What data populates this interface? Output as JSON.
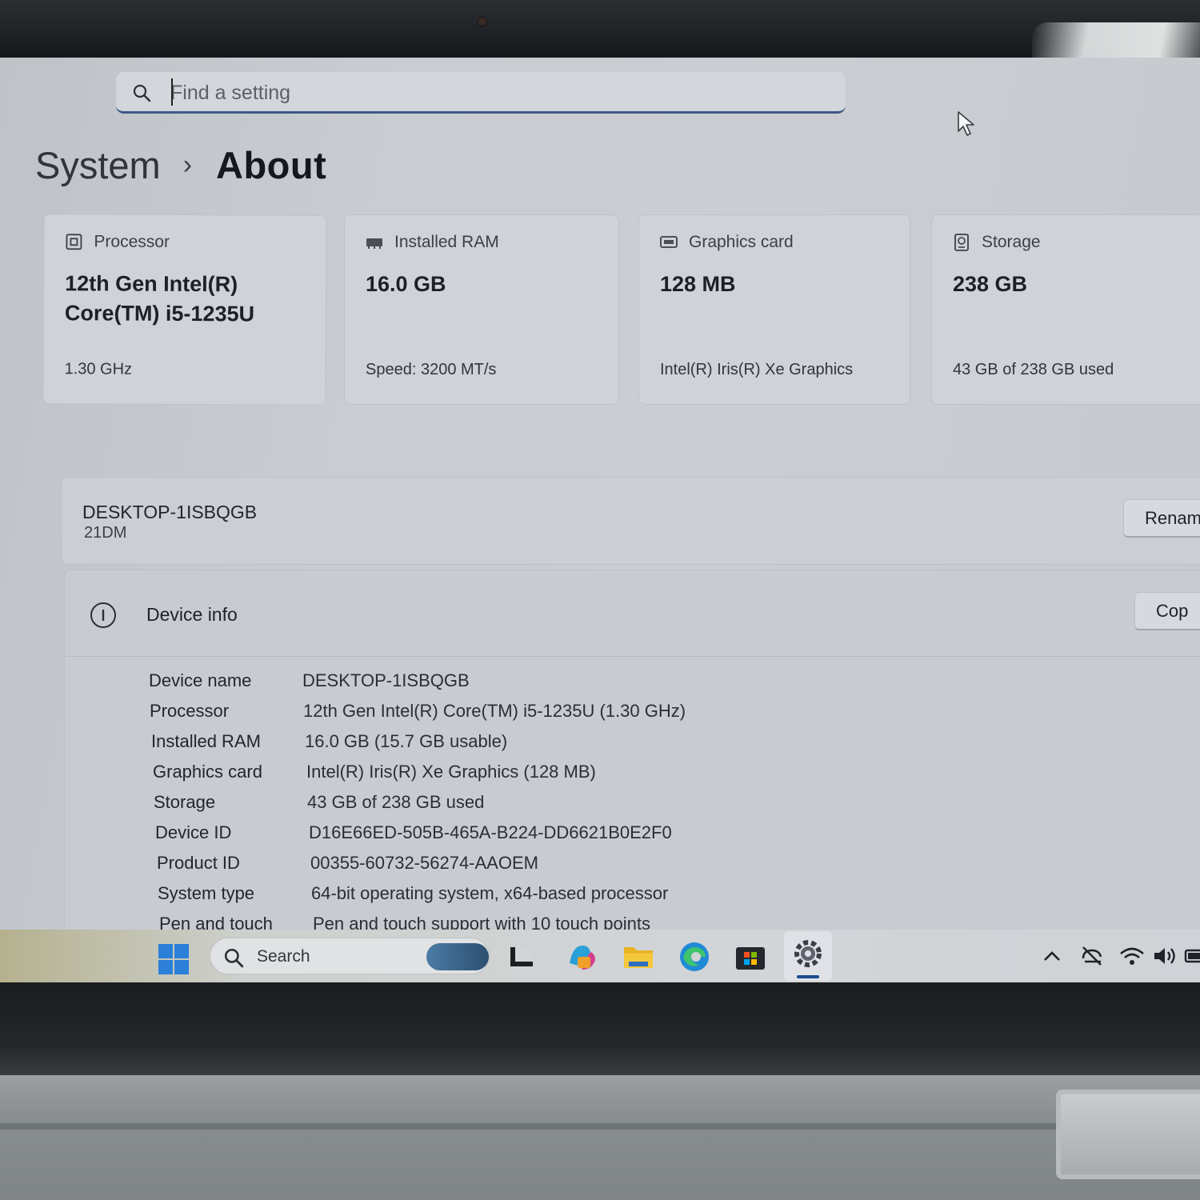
{
  "search": {
    "placeholder": "Find a setting"
  },
  "breadcrumb": {
    "parent": "System",
    "separator": "›",
    "current": "About"
  },
  "cards": [
    {
      "title": "Processor",
      "icon": "processor-icon",
      "value": "12th Gen Intel(R) Core(TM) i5-1235U",
      "sub": "1.30 GHz"
    },
    {
      "title": "Installed RAM",
      "icon": "ram-icon",
      "value": "16.0 GB",
      "sub": "Speed: 3200 MT/s"
    },
    {
      "title": "Graphics card",
      "icon": "graphics-card-icon",
      "value": "128 MB",
      "sub": "Intel(R) Iris(R) Xe Graphics"
    },
    {
      "title": "Storage",
      "icon": "storage-icon",
      "value": "238 GB",
      "sub": "43 GB of 238 GB used"
    }
  ],
  "device": {
    "name": "DESKTOP-1ISBQGB",
    "model": "21DM",
    "rename_label": "Renam"
  },
  "device_info": {
    "title": "Device info",
    "copy_label": "Cop",
    "rows": [
      {
        "label": "Device name",
        "value": "DESKTOP-1ISBQGB"
      },
      {
        "label": "Processor",
        "value": "12th Gen Intel(R) Core(TM) i5-1235U (1.30 GHz)"
      },
      {
        "label": "Installed RAM",
        "value": "16.0 GB (15.7 GB usable)"
      },
      {
        "label": "Graphics card",
        "value": "Intel(R) Iris(R) Xe Graphics (128 MB)"
      },
      {
        "label": "Storage",
        "value": "43 GB of 238 GB used"
      },
      {
        "label": "Device ID",
        "value": "D16E66ED-505B-465A-B224-DD6621B0E2F0"
      },
      {
        "label": "Product ID",
        "value": "00355-60732-56274-AAOEM"
      },
      {
        "label": "System type",
        "value": "64-bit operating system, x64-based processor"
      },
      {
        "label": "Pen and touch",
        "value": "Pen and touch support with 10 touch points"
      }
    ]
  },
  "taskbar": {
    "search_label": "Search",
    "apps": [
      "task-view-icon",
      "copilot-icon",
      "file-explorer-icon",
      "edge-icon",
      "store-icon",
      "settings-icon"
    ],
    "tray": [
      "chevron-up-icon",
      "sync-off-icon",
      "wifi-icon",
      "volume-icon",
      "battery-icon"
    ]
  },
  "colors": {
    "accent": "#3d5a86",
    "active_indicator": "#1c4b8f"
  }
}
